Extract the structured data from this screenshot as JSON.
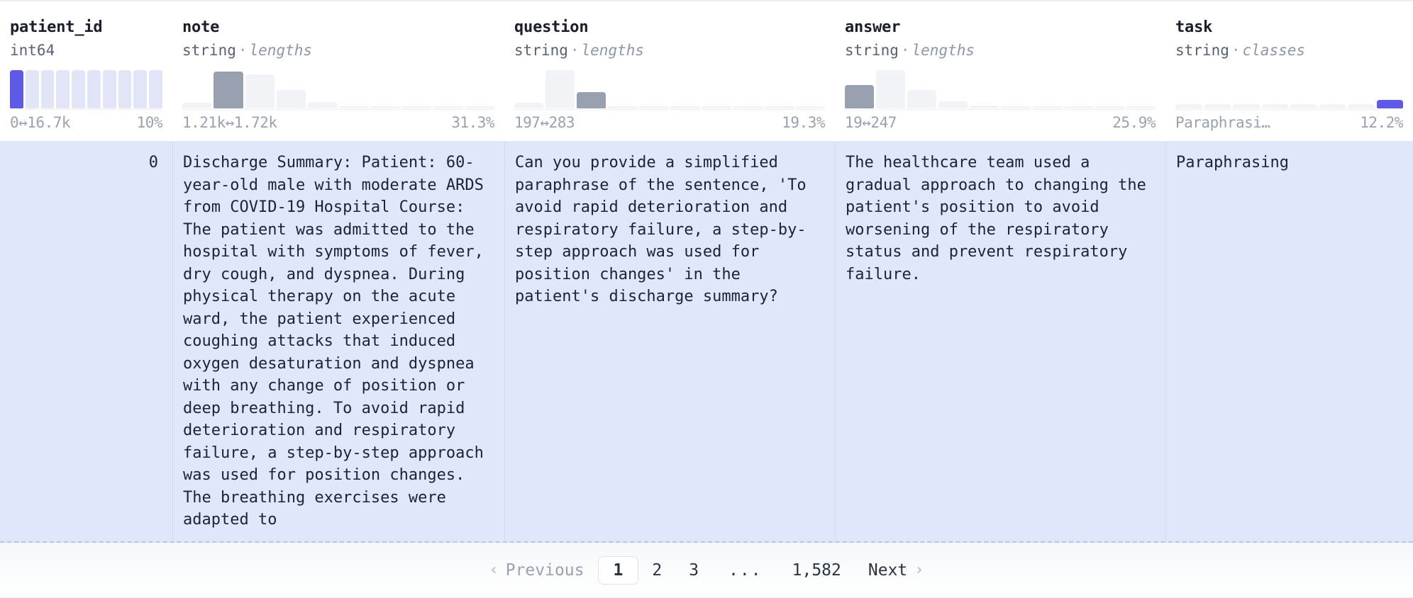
{
  "columns": [
    {
      "name": "patient_id",
      "type": "int64",
      "subtype": "",
      "stat_kind": "numeric",
      "range_label": "0↔16.7k",
      "range_min": "0",
      "range_max": "16.7k",
      "pct_label": "10%",
      "histogram": {
        "type": "bar",
        "values": [
          100,
          100,
          100,
          100,
          100,
          100,
          100,
          100,
          100,
          100
        ],
        "highlight_index": 0,
        "highlight_color": "#5f5ae6",
        "base_color": "#e2e4f8"
      }
    },
    {
      "name": "note",
      "type": "string",
      "subtype": "lengths",
      "stat_kind": "lengths",
      "range_label": "1.21k↔1.72k",
      "range_min": "1.21k",
      "range_max": "1.72k",
      "pct_label": "31.3%",
      "histogram": {
        "type": "bar",
        "values": [
          14,
          96,
          88,
          48,
          16,
          6,
          6,
          6,
          6,
          6
        ],
        "highlight_index": 1,
        "highlight_color": "#99a0b0",
        "base_color": "#f2f3f6"
      }
    },
    {
      "name": "question",
      "type": "string",
      "subtype": "lengths",
      "stat_kind": "lengths",
      "range_label": "197↔283",
      "range_min": "197",
      "range_max": "283",
      "pct_label": "19.3%",
      "histogram": {
        "type": "bar",
        "values": [
          14,
          100,
          42,
          5,
          5,
          5,
          5,
          5,
          5,
          5
        ],
        "highlight_index": 2,
        "highlight_color": "#99a0b0",
        "base_color": "#f2f3f6"
      }
    },
    {
      "name": "answer",
      "type": "string",
      "subtype": "lengths",
      "stat_kind": "lengths",
      "range_label": "19↔247",
      "range_min": "19",
      "range_max": "247",
      "pct_label": "25.9%",
      "histogram": {
        "type": "bar",
        "values": [
          62,
          100,
          48,
          18,
          8,
          6,
          6,
          6,
          6,
          6
        ],
        "highlight_index": 0,
        "highlight_color": "#99a0b0",
        "base_color": "#f2f3f6"
      }
    },
    {
      "name": "task",
      "type": "string",
      "subtype": "classes",
      "stat_kind": "classes",
      "range_label": "Paraphrasi…",
      "range_min": "Paraphrasi…",
      "range_max": "",
      "pct_label": "12.2%",
      "histogram": {
        "type": "bar",
        "values": [
          12,
          12,
          12,
          12,
          12,
          12,
          12,
          12
        ],
        "highlight_index": 7,
        "highlight_color": "#5f5ae6",
        "base_color": "#f2f3f6"
      }
    }
  ],
  "rows": [
    {
      "patient_id": "0",
      "note": "Discharge Summary: Patient: 60-year-old male with moderate ARDS from COVID-19 Hospital Course: The patient was admitted to the hospital with symptoms of fever, dry cough, and dyspnea. During physical therapy on the acute ward, the patient experienced coughing attacks that induced oxygen desaturation and dyspnea with any change of position or deep breathing. To avoid rapid deterioration and respiratory failure, a step-by-step approach was used for position changes. The breathing exercises were adapted to",
      "question": "Can you provide a simplified paraphrase of the sentence, 'To avoid rapid deterioration and respiratory failure, a step-by-step approach was used for position changes' in the patient's discharge summary?",
      "answer": "The healthcare team used a gradual approach to changing the patient's position to avoid worsening of the respiratory status and prevent respiratory failure.",
      "task": "Paraphrasing"
    }
  ],
  "pagination": {
    "previous_label": "Previous",
    "previous_chevron": "‹",
    "next_label": "Next",
    "next_chevron": "›",
    "pages": [
      "1",
      "2",
      "3"
    ],
    "ellipsis": "...",
    "last_page": "1,582",
    "current_page": "1"
  },
  "theme": {
    "row_highlight_bg": "#dfe8fa",
    "accent": "#5f5ae6",
    "slate": "#99a0b0",
    "text": "#1b2433",
    "muted": "#9aa1b1"
  }
}
